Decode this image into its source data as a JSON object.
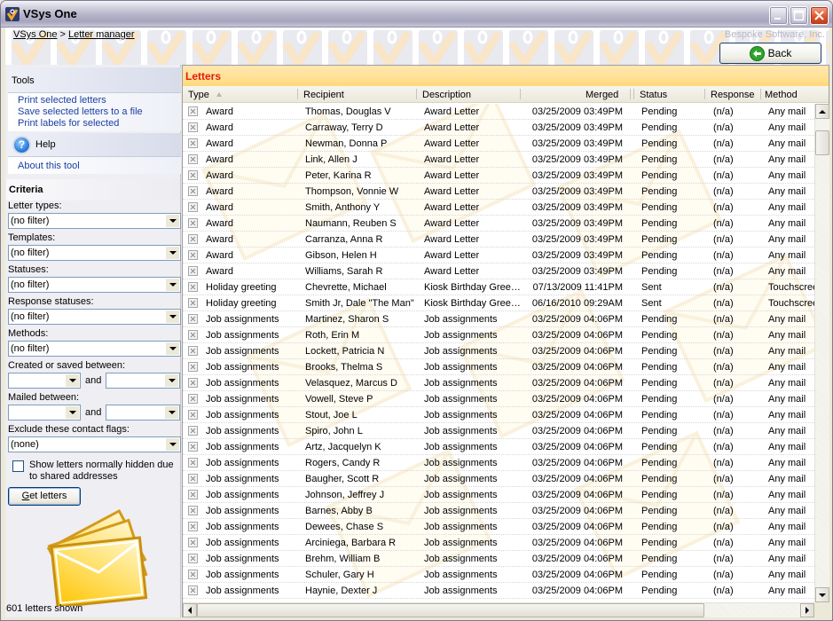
{
  "window": {
    "title": "VSys One",
    "controls": {
      "minimize": "minimize",
      "maximize": "maximize",
      "close": "close"
    }
  },
  "breadcrumb": {
    "root": "VSys One",
    "separator": ">",
    "current": "Letter manager"
  },
  "vendor": "Bespoke Software, Inc.",
  "back_button": {
    "label": "Back",
    "icon": "arrow-left-circle-icon"
  },
  "sidebar": {
    "tools": {
      "title": "Tools",
      "links": [
        "Print selected letters",
        "Save selected letters to a file",
        "Print labels for selected"
      ]
    },
    "help": {
      "title": "Help",
      "links": [
        "About this tool"
      ]
    },
    "criteria": {
      "title": "Criteria",
      "fields": [
        {
          "label": "Letter types:",
          "value": "(no filter)"
        },
        {
          "label": "Templates:",
          "value": "(no filter)"
        },
        {
          "label": "Statuses:",
          "value": "(no filter)"
        },
        {
          "label": "Response statuses:",
          "value": "(no filter)"
        },
        {
          "label": "Methods:",
          "value": "(no filter)"
        }
      ],
      "created_between": {
        "label": "Created or saved between:",
        "from": "",
        "and_label": "and",
        "to": ""
      },
      "mailed_between": {
        "label": "Mailed between:",
        "from": "",
        "and_label": "and",
        "to": ""
      },
      "exclude_flags": {
        "label": "Exclude these contact flags:",
        "value": "(none)"
      },
      "show_hidden": {
        "label": "Show letters normally hidden due to shared addresses",
        "checked": false
      },
      "get_letters_button": {
        "accesskey": "G",
        "label_rest": "et letters"
      }
    },
    "status": "601 letters shown"
  },
  "letters": {
    "title": "Letters",
    "columns": [
      "Type",
      "Recipient",
      "Description",
      "Merged",
      "Status",
      "Response",
      "Method"
    ],
    "sort_column": "Type",
    "rows": [
      [
        "Award",
        "Thomas, Douglas V",
        "Award Letter",
        "03/25/2009 03:49PM",
        "Pending",
        "(n/a)",
        "Any mail"
      ],
      [
        "Award",
        "Carraway, Terry D",
        "Award Letter",
        "03/25/2009 03:49PM",
        "Pending",
        "(n/a)",
        "Any mail"
      ],
      [
        "Award",
        "Newman, Donna P",
        "Award Letter",
        "03/25/2009 03:49PM",
        "Pending",
        "(n/a)",
        "Any mail"
      ],
      [
        "Award",
        "Link, Allen J",
        "Award Letter",
        "03/25/2009 03:49PM",
        "Pending",
        "(n/a)",
        "Any mail"
      ],
      [
        "Award",
        "Peter, Karina R",
        "Award Letter",
        "03/25/2009 03:49PM",
        "Pending",
        "(n/a)",
        "Any mail"
      ],
      [
        "Award",
        "Thompson, Vonnie W",
        "Award Letter",
        "03/25/2009 03:49PM",
        "Pending",
        "(n/a)",
        "Any mail"
      ],
      [
        "Award",
        "Smith, Anthony Y",
        "Award Letter",
        "03/25/2009 03:49PM",
        "Pending",
        "(n/a)",
        "Any mail"
      ],
      [
        "Award",
        "Naumann, Reuben S",
        "Award Letter",
        "03/25/2009 03:49PM",
        "Pending",
        "(n/a)",
        "Any mail"
      ],
      [
        "Award",
        "Carranza, Anna R",
        "Award Letter",
        "03/25/2009 03:49PM",
        "Pending",
        "(n/a)",
        "Any mail"
      ],
      [
        "Award",
        "Gibson, Helen H",
        "Award Letter",
        "03/25/2009 03:49PM",
        "Pending",
        "(n/a)",
        "Any mail"
      ],
      [
        "Award",
        "Williams, Sarah R",
        "Award Letter",
        "03/25/2009 03:49PM",
        "Pending",
        "(n/a)",
        "Any mail"
      ],
      [
        "Holiday greeting",
        "Chevrette, Michael",
        "Kiosk Birthday Gree…",
        "07/13/2009 11:41PM",
        "Sent",
        "(n/a)",
        "Touchscree"
      ],
      [
        "Holiday greeting",
        "Smith Jr, Dale \"The Man\"",
        "Kiosk Birthday Gree…",
        "06/16/2010 09:29AM",
        "Sent",
        "(n/a)",
        "Touchscree"
      ],
      [
        "Job assignments",
        "Martinez, Sharon S",
        "Job assignments",
        "03/25/2009 04:06PM",
        "Pending",
        "(n/a)",
        "Any mail"
      ],
      [
        "Job assignments",
        "Roth, Erin M",
        "Job assignments",
        "03/25/2009 04:06PM",
        "Pending",
        "(n/a)",
        "Any mail"
      ],
      [
        "Job assignments",
        "Lockett, Patricia N",
        "Job assignments",
        "03/25/2009 04:06PM",
        "Pending",
        "(n/a)",
        "Any mail"
      ],
      [
        "Job assignments",
        "Brooks, Thelma S",
        "Job assignments",
        "03/25/2009 04:06PM",
        "Pending",
        "(n/a)",
        "Any mail"
      ],
      [
        "Job assignments",
        "Velasquez, Marcus D",
        "Job assignments",
        "03/25/2009 04:06PM",
        "Pending",
        "(n/a)",
        "Any mail"
      ],
      [
        "Job assignments",
        "Vowell, Steve P",
        "Job assignments",
        "03/25/2009 04:06PM",
        "Pending",
        "(n/a)",
        "Any mail"
      ],
      [
        "Job assignments",
        "Stout, Joe L",
        "Job assignments",
        "03/25/2009 04:06PM",
        "Pending",
        "(n/a)",
        "Any mail"
      ],
      [
        "Job assignments",
        "Spiro, John L",
        "Job assignments",
        "03/25/2009 04:06PM",
        "Pending",
        "(n/a)",
        "Any mail"
      ],
      [
        "Job assignments",
        "Artz, Jacquelyn K",
        "Job assignments",
        "03/25/2009 04:06PM",
        "Pending",
        "(n/a)",
        "Any mail"
      ],
      [
        "Job assignments",
        "Rogers, Candy R",
        "Job assignments",
        "03/25/2009 04:06PM",
        "Pending",
        "(n/a)",
        "Any mail"
      ],
      [
        "Job assignments",
        "Baugher, Scott R",
        "Job assignments",
        "03/25/2009 04:06PM",
        "Pending",
        "(n/a)",
        "Any mail"
      ],
      [
        "Job assignments",
        "Johnson, Jeffrey J",
        "Job assignments",
        "03/25/2009 04:06PM",
        "Pending",
        "(n/a)",
        "Any mail"
      ],
      [
        "Job assignments",
        "Barnes, Abby B",
        "Job assignments",
        "03/25/2009 04:06PM",
        "Pending",
        "(n/a)",
        "Any mail"
      ],
      [
        "Job assignments",
        "Dewees, Chase S",
        "Job assignments",
        "03/25/2009 04:06PM",
        "Pending",
        "(n/a)",
        "Any mail"
      ],
      [
        "Job assignments",
        "Arciniega, Barbara R",
        "Job assignments",
        "03/25/2009 04:06PM",
        "Pending",
        "(n/a)",
        "Any mail"
      ],
      [
        "Job assignments",
        "Brehm, William B",
        "Job assignments",
        "03/25/2009 04:06PM",
        "Pending",
        "(n/a)",
        "Any mail"
      ],
      [
        "Job assignments",
        "Schuler, Gary H",
        "Job assignments",
        "03/25/2009 04:06PM",
        "Pending",
        "(n/a)",
        "Any mail"
      ],
      [
        "Job assignments",
        "Haynie, Dexter J",
        "Job assignments",
        "03/25/2009 04:06PM",
        "Pending",
        "(n/a)",
        "Any mail"
      ]
    ]
  },
  "colors": {
    "letters_title": "#e41b0f",
    "link": "#1b3fa3",
    "header_gold": "#ffe194"
  }
}
